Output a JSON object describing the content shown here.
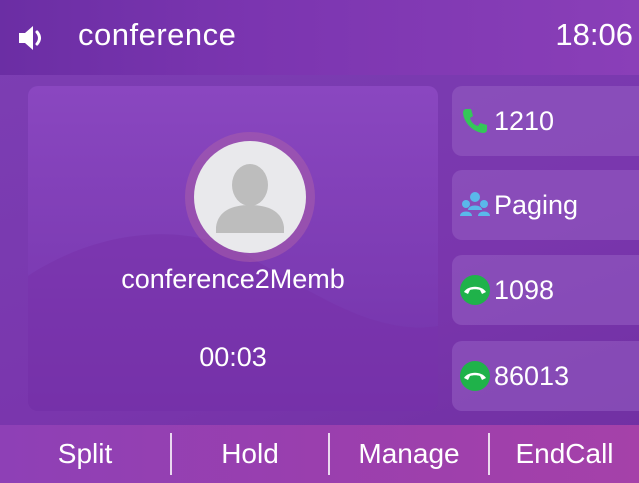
{
  "status_bar": {
    "title": "conference",
    "time": "18:06",
    "icon": "speaker-icon"
  },
  "call": {
    "name": "conference2Memb",
    "timer": "00:03",
    "avatar_icon": "person-silhouette-icon"
  },
  "line_keys": [
    {
      "label": "1210",
      "icon": "phone-handset-icon",
      "icon_color": "#34c759"
    },
    {
      "label": "Paging",
      "icon": "paging-group-icon",
      "icon_color": "#5ab8ea"
    },
    {
      "label": "1098",
      "icon": "hangup-icon",
      "icon_color": "#1fb24a"
    },
    {
      "label": "86013",
      "icon": "hangup-icon",
      "icon_color": "#1fb24a"
    }
  ],
  "softkeys": {
    "split": "Split",
    "hold": "Hold",
    "manage": "Manage",
    "endcall": "EndCall"
  },
  "colors": {
    "background": "#7a38ae",
    "softkey_bar": "#9a3fae",
    "line_key_bg": "#9a63c5"
  }
}
